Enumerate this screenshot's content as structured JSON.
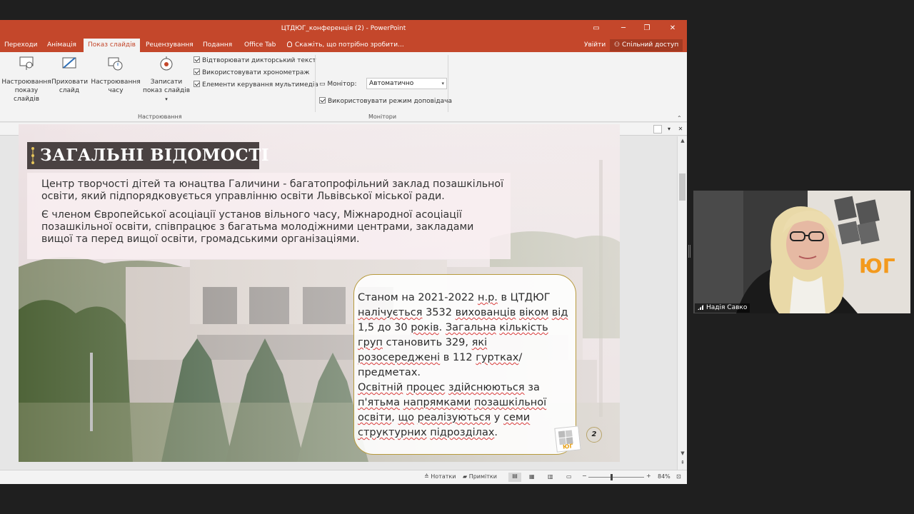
{
  "window": {
    "title": "ЦТДЮГ_конференція (2) - PowerPoint",
    "controls": {
      "minimize": "─",
      "restore": "❐",
      "close": "✕"
    }
  },
  "tabs": [
    {
      "label": "Переходи"
    },
    {
      "label": "Анімація"
    },
    {
      "label": "Показ слайдів",
      "active": true
    },
    {
      "label": "Рецензування"
    },
    {
      "label": "Подання"
    },
    {
      "label": "Office Tab"
    }
  ],
  "tell_me": "Скажіть, що потрібно зробити...",
  "account": {
    "signin": "Увійти",
    "share": "Спільний доступ"
  },
  "ribbon": {
    "setup_show": "Настроювання показу слайдів",
    "hide_slide": "Приховати слайд",
    "rehearse": "Настроювання часу",
    "record": "Записати показ слайдів",
    "checks": [
      "Відтворювати дикторський текст",
      "Використовувати хронометраж",
      "Елементи керування мультимедіа"
    ],
    "group_setup": "Настроювання",
    "monitor_label": "Монітор:",
    "monitor_value": "Автоматично",
    "presenter_view": "Використовувати режим доповідача",
    "group_monitors": "Монітори"
  },
  "slide": {
    "heading": "ЗАГАЛЬНІ ВІДОМОСТІ",
    "intro1": "Центр творчості дітей та юнацтва Галичини - багатопрофільний заклад позашкільної освіти, який підпорядковується управлінню освіти Львівської міської ради.",
    "intro2": "Є членом Європейської асоціації установ вільного часу, Міжнародної асоціації позашкільної освіти, співпрацює з багатьма молодіжними центрами, закладами вищої та перед вищої освіти, громадськими організаціями.",
    "stats": {
      "s1": "Станом на 2021-2022 ",
      "s2": "н.р.",
      "s3": " в ЦТДЮГ ",
      "s4": "налічується",
      "s5": " 3532 ",
      "s6": "вихованців",
      "s7": " ",
      "s8": "віком",
      "s9": " ",
      "s10": "від",
      "s11": " 1,5 до 30 ",
      "s12": "років",
      "s13": ". ",
      "s14": "Загальна",
      "s15": " ",
      "s16": "кількість",
      "s17": " ",
      "s18": "груп",
      "s19": " становить 329, ",
      "s20": "які",
      "s21": " ",
      "s22": "розосереджені",
      "s23": " в 112 ",
      "s24": "гуртках",
      "s25": "/предметах.",
      "s26": "Освітній",
      "s27": " ",
      "s28": "процес",
      "s29": " ",
      "s30": "здійснюються",
      "s31": " за ",
      "s32": "п'ятьма",
      "s33": " ",
      "s34": "напрямками",
      "s35": " ",
      "s36": "позашкільної",
      "s37": " ",
      "s38": "освіти",
      "s39": ", ",
      "s40": "що",
      "s41": " ",
      "s42": "реалізуються",
      "s43": " у ",
      "s44": "семи",
      "s45": " ",
      "s46": "структурних",
      "s47": " ",
      "s48": "підрозділах",
      "s49": "."
    },
    "page_number": "2",
    "logo_text": "ЮГ"
  },
  "status": {
    "notes": "Нотатки",
    "comments": "Примітки",
    "zoom": "84%",
    "zoom_minus": "−",
    "zoom_plus": "+"
  },
  "camera": {
    "name": "Надія Савко",
    "sign_text": "ЮГ"
  },
  "colors": {
    "accent": "#c4472b",
    "ribbon_bg": "#f3f3f3",
    "heading_bar": "#4a4242",
    "stat_border": "#b79a3c"
  }
}
